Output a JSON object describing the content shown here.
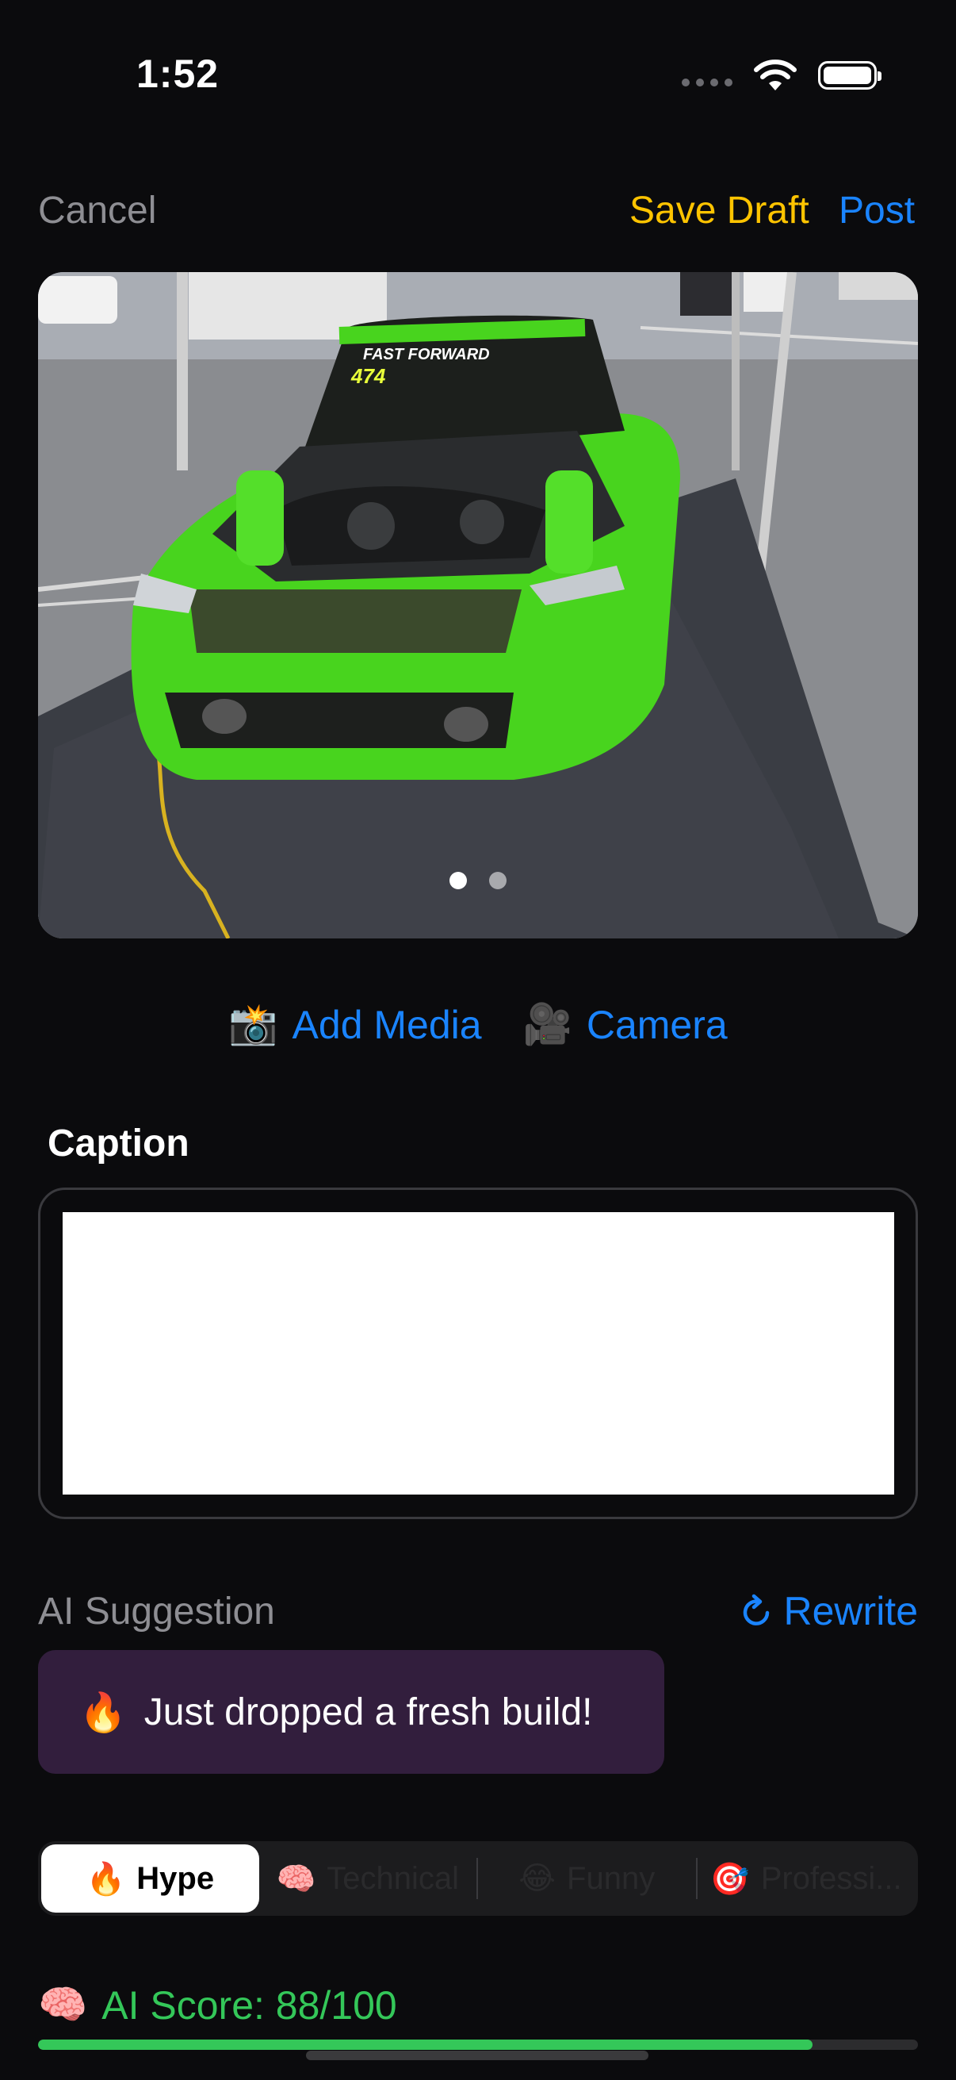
{
  "status_bar": {
    "time": "1:52"
  },
  "nav": {
    "cancel_label": "Cancel",
    "save_draft_label": "Save Draft",
    "post_label": "Post"
  },
  "media": {
    "page_count": 2,
    "current_page": 1,
    "add_media_icon": "📸",
    "add_media_label": "Add Media",
    "camera_icon": "🎥",
    "camera_label": "Camera"
  },
  "caption": {
    "label": "Caption",
    "value": ""
  },
  "ai_suggestion": {
    "label": "AI Suggestion",
    "rewrite_label": "Rewrite",
    "text_emoji": "🔥",
    "text": "Just dropped a fresh build!"
  },
  "tone_tabs": [
    {
      "emoji": "🔥",
      "label": "Hype",
      "selected": true
    },
    {
      "emoji": "🧠",
      "label": "Technical",
      "selected": false
    },
    {
      "emoji": "😂",
      "label": "Funny",
      "selected": false
    },
    {
      "emoji": "🎯",
      "label": "Professi...",
      "selected": false
    }
  ],
  "ai_score": {
    "emoji": "🧠",
    "text": "AI Score: 88/100",
    "value": 88,
    "max": 100
  },
  "colors": {
    "accent_blue": "#1a84ff",
    "draft_yellow": "#ffc400",
    "score_green": "#34c759",
    "suggestion_bg": "#321e3d"
  }
}
